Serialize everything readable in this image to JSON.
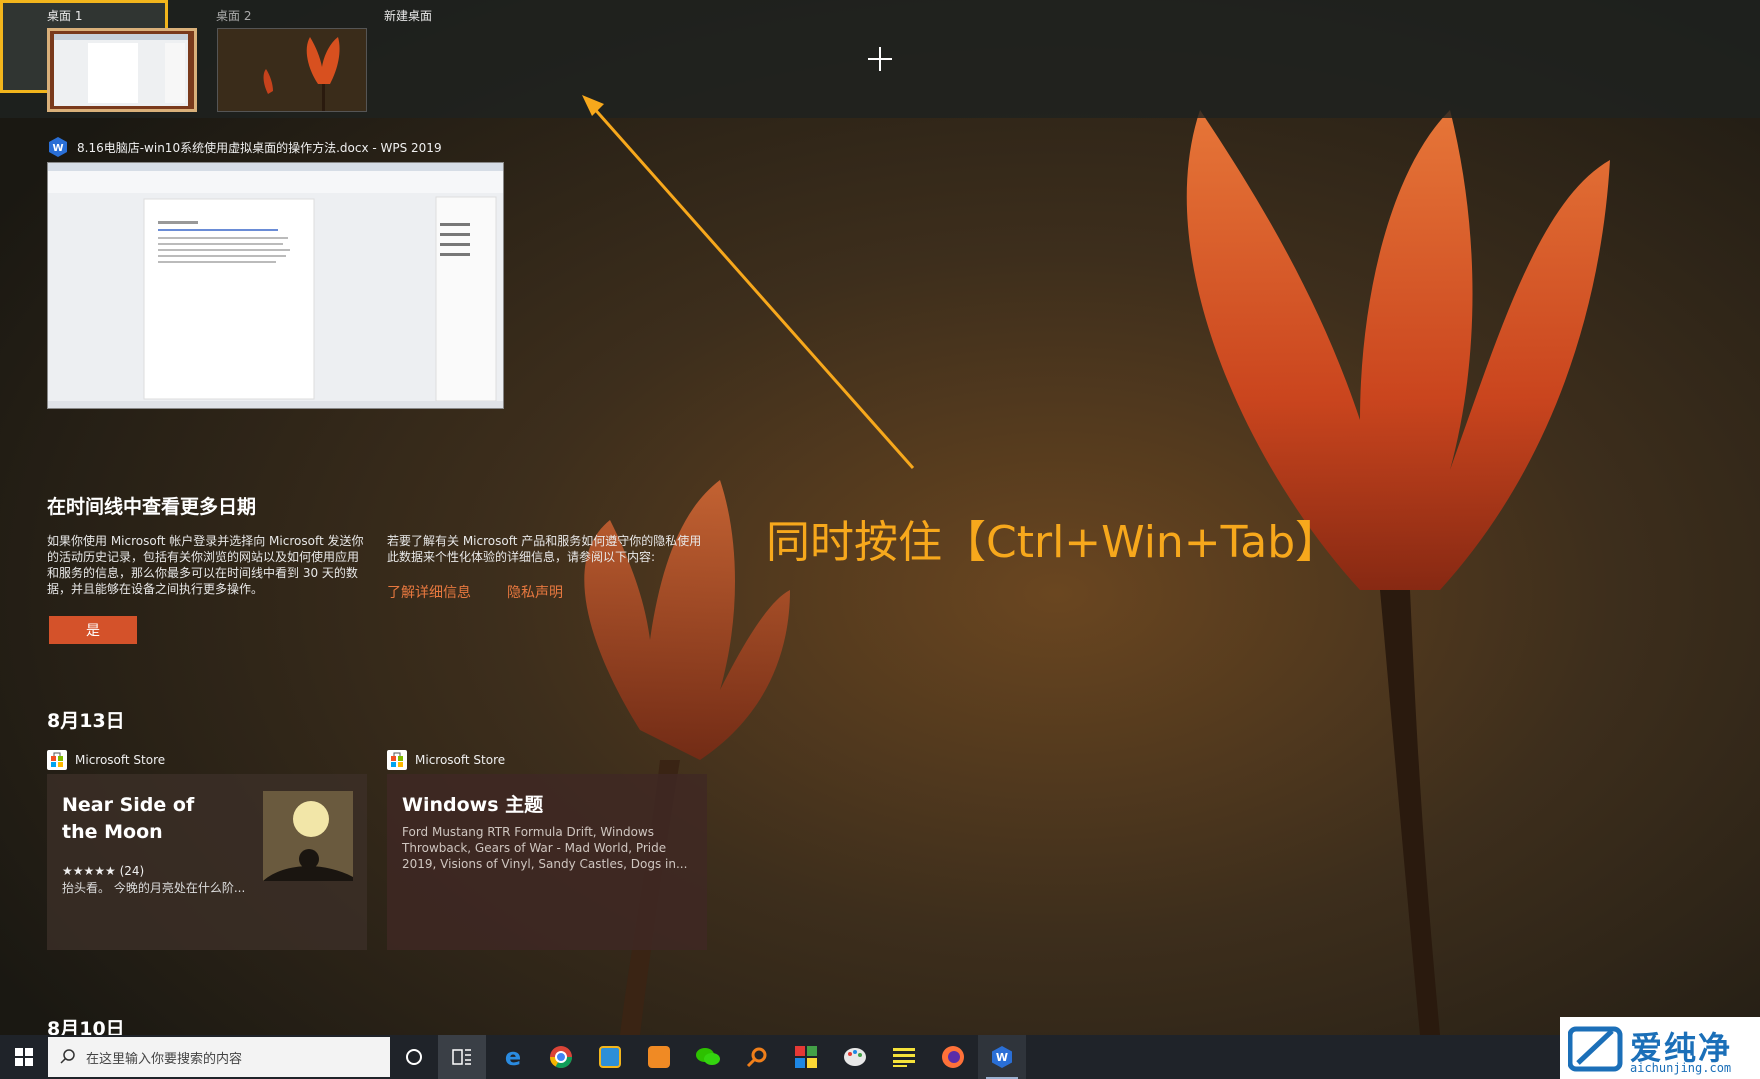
{
  "desktops": [
    {
      "label": "桌面 1"
    },
    {
      "label": "桌面 2"
    },
    {
      "label": "新建桌面"
    }
  ],
  "open_window": {
    "title": "8.16电脑店-win10系统使用虚拟桌面的操作方法.docx - WPS 2019",
    "icon": "wps-writer-icon"
  },
  "timeline_notice": {
    "heading": "在时间线中查看更多日期",
    "body": "如果你使用 Microsoft 帐户登录并选择向 Microsoft 发送你的活动历史记录，包括有关你浏览的网站以及如何使用应用和服务的信息，那么你最多可以在时间线中看到 30 天的数据，并且能够在设备之间执行更多操作。",
    "privacy_body": "若要了解有关 Microsoft 产品和服务如何遵守你的隐私使用此数据来个性化体验的详细信息，请参阅以下内容:",
    "learn_more_link": "了解详细信息",
    "privacy_link": "隐私声明",
    "yes_button": "是"
  },
  "sections": [
    {
      "date": "8月13日",
      "activities": [
        {
          "app": "Microsoft Store",
          "title": "Near Side of the Moon",
          "rating": "★★★★★ (24)",
          "description": "抬头看。 今晚的月亮处在什么阶..."
        },
        {
          "app": "Microsoft Store",
          "title": "Windows 主题",
          "description": "Ford Mustang RTR Formula Drift, Windows Throwback, Gears of War - Mad World, Pride 2019, Visions of Vinyl, Sandy Castles, Dogs in..."
        }
      ]
    },
    {
      "date": "8月10日"
    }
  ],
  "annotation": {
    "text": "同时按住【Ctrl+Win+Tab】",
    "color": "#f7a81c"
  },
  "taskbar": {
    "search_placeholder": "在这里输入你要搜索的内容",
    "apps": [
      "edge-icon",
      "chrome-icon",
      "app-icon",
      "wps-app-icon",
      "wechat-icon",
      "search-app-icon",
      "color-blocks-icon",
      "paint-icon",
      "notes-icon",
      "firefox-icon",
      "wps-writer-icon"
    ]
  },
  "watermark": {
    "cn": "爱纯净",
    "en": "aichunjing.com"
  }
}
